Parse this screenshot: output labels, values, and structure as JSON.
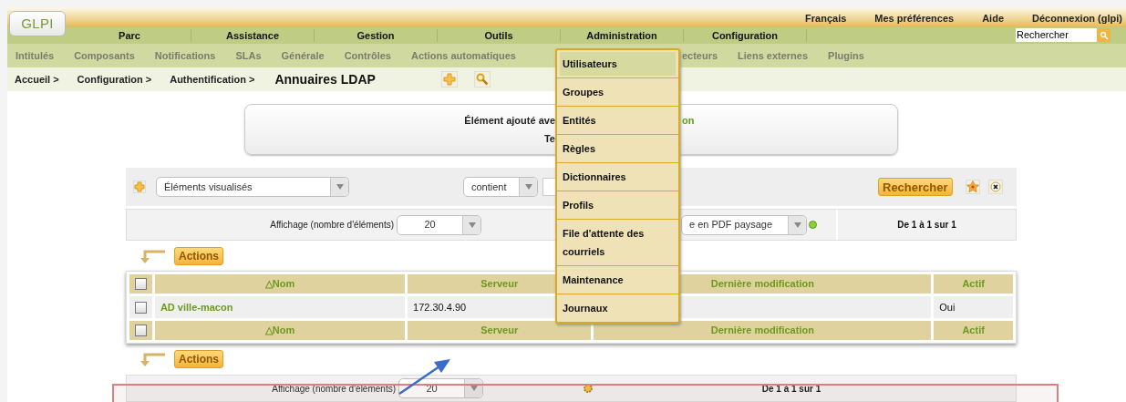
{
  "header": {
    "logo": "GLPI",
    "top_links": [
      "Français",
      "Mes préférences",
      "Aide",
      "Déconnexion (glpi)"
    ],
    "search": {
      "value": "Rechercher"
    }
  },
  "main_menu": [
    "Parc",
    "Assistance",
    "Gestion",
    "Outils",
    "Administration",
    "Configuration"
  ],
  "sub_menu": [
    {
      "label": "Intitulés",
      "kind": "full"
    },
    {
      "label": "Composants",
      "kind": "full"
    },
    {
      "label": "Notifications",
      "kind": "full"
    },
    {
      "label": "SLAs",
      "kind": "full"
    },
    {
      "label": "Générale",
      "kind": "full"
    },
    {
      "label": "Contrôles",
      "kind": "full"
    },
    {
      "label": "Actions automatiques",
      "kind": "full"
    },
    {
      "label": "ecteurs",
      "kind": "cut"
    },
    {
      "label": "Liens externes",
      "kind": "full"
    },
    {
      "label": "Plugins",
      "kind": "full"
    }
  ],
  "breadcrumb": {
    "items": [
      "Accueil >",
      "Configuration >",
      "Authentification >"
    ],
    "title": "Annuaires LDAP"
  },
  "dropdown": [
    {
      "label": "Utilisateurs",
      "selected": true
    },
    {
      "label": "Groupes",
      "selected": false
    },
    {
      "label": "Entités",
      "selected": false
    },
    {
      "label": "Règles",
      "selected": false
    },
    {
      "label": "Dictionnaires",
      "selected": false
    },
    {
      "label": "Profils",
      "selected": false
    },
    {
      "label": "File d'attente des courriels",
      "selected": false
    },
    {
      "label": "Maintenance",
      "selected": false
    },
    {
      "label": "Journaux",
      "selected": false
    }
  ],
  "message": {
    "text": "Élément ajouté ave",
    "name": "on",
    "line2": "Te"
  },
  "search_bar": {
    "field": "Éléments visualisés",
    "operator": "contient",
    "button": "Rechercher"
  },
  "pagination": {
    "label": "Affichage (nombre d'éléments)",
    "value": "20",
    "export": "e en PDF paysage",
    "range": "De 1 à 1 sur 1"
  },
  "actions": [
    "Actions",
    "Actions"
  ],
  "table": {
    "header": [
      "△Nom",
      "Serveur",
      "Dernière modification",
      "Actif"
    ],
    "header_checked": false,
    "rows": [
      {
        "name": "AD ville-macon",
        "server": "172.30.4.90",
        "active": "Oui",
        "checked": false
      }
    ],
    "footer": [
      "△Nom",
      "Serveur",
      "Dernière modification",
      "Actif"
    ],
    "footer_checked": false
  },
  "bottom_pagination": {
    "label": "Affichage (nombre d'éléments)",
    "value": "20",
    "range": "De 1 à 1 sur 1"
  }
}
